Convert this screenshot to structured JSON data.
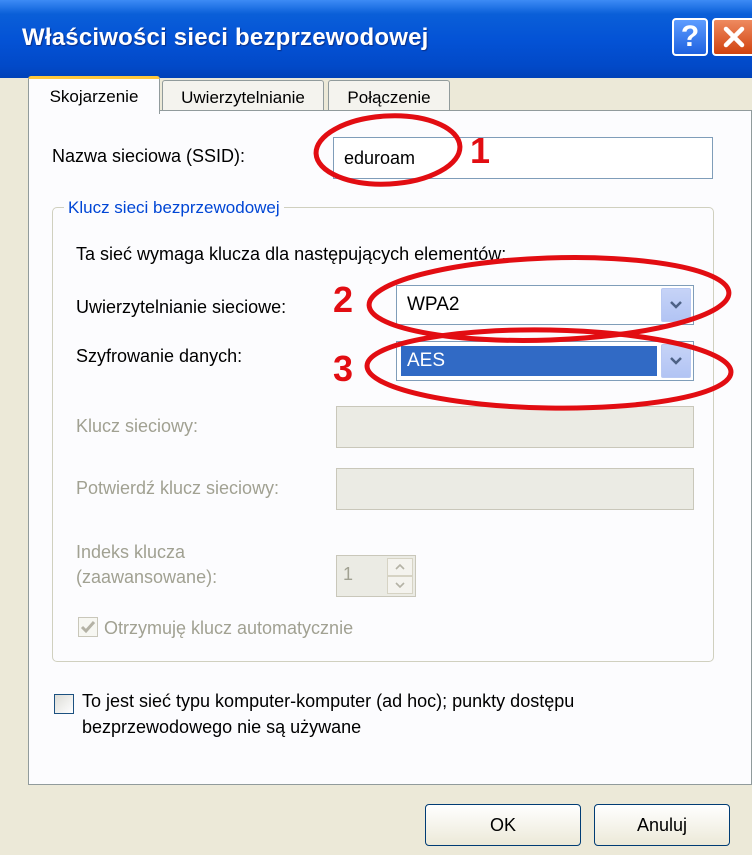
{
  "window": {
    "title": "Właściwości sieci bezprzewodowej"
  },
  "tabs": [
    {
      "label": "Skojarzenie",
      "active": true
    },
    {
      "label": "Uwierzytelnianie",
      "active": false
    },
    {
      "label": "Połączenie",
      "active": false
    }
  ],
  "ssid": {
    "label": "Nazwa sieciowa (SSID):",
    "value": "eduroam"
  },
  "key_group": {
    "legend": "Klucz sieci bezprzewodowej",
    "description": "Ta sieć wymaga klucza dla następujących elementów:",
    "auth": {
      "label": "Uwierzytelnianie sieciowe:",
      "value": "WPA2"
    },
    "encryption": {
      "label": "Szyfrowanie danych:",
      "value": "AES"
    },
    "network_key": {
      "label": "Klucz sieciowy:",
      "value": ""
    },
    "confirm_key": {
      "label": "Potwierdź klucz sieciowy:",
      "value": ""
    },
    "key_index": {
      "label_line1": "Indeks klucza",
      "label_line2": "(zaawansowane):",
      "value": "1"
    },
    "auto_key": {
      "label": "Otrzymuję klucz automatycznie",
      "checked": true
    }
  },
  "adhoc": {
    "line1": "To jest sieć typu komputer-komputer (ad hoc); punkty dostępu",
    "line2": "bezprzewodowego nie są używane",
    "checked": false
  },
  "buttons": {
    "ok": "OK",
    "cancel": "Anuluj"
  },
  "annotations": [
    "1",
    "2",
    "3"
  ],
  "colors": {
    "annotation": "#e20d12",
    "title_bar": "#0453d6",
    "legend": "#0046d5",
    "selection": "#316ac5"
  }
}
